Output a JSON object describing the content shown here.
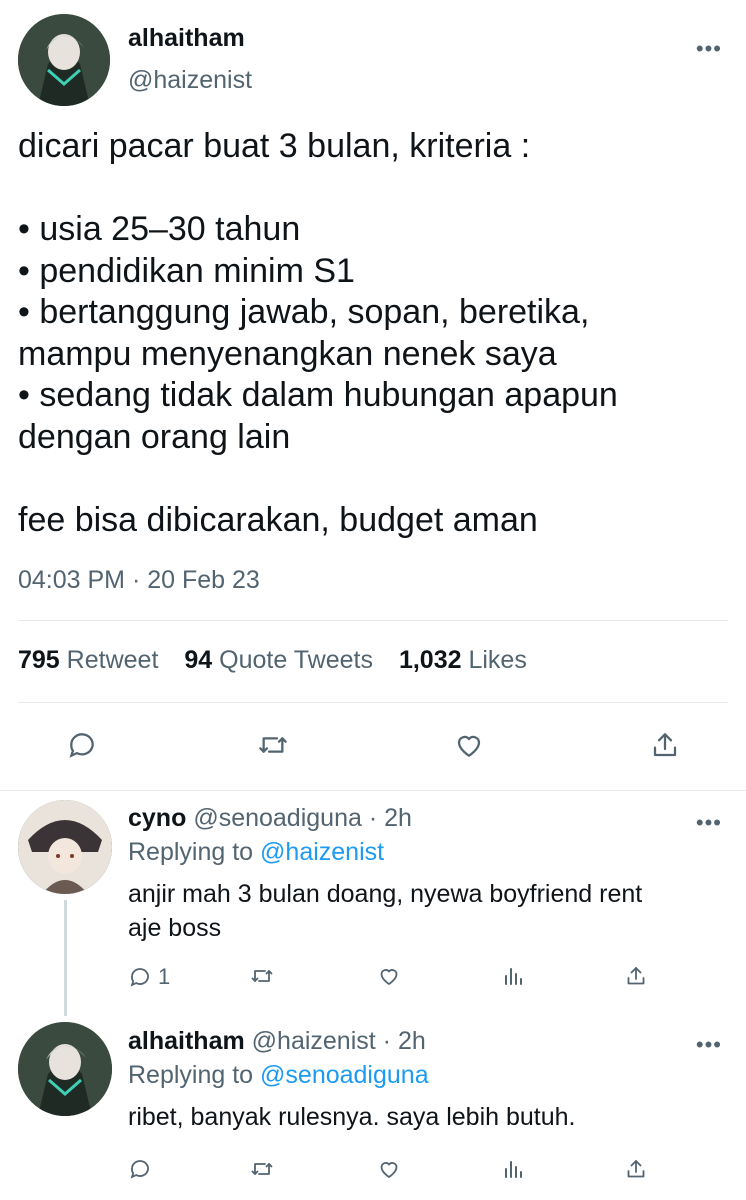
{
  "main_tweet": {
    "display_name": "alhaitham",
    "handle": "@haizenist",
    "more": "•••",
    "text": "dicari pacar buat 3 bulan, kriteria :\n\n• usia 25–30 tahun\n• pendidikan minim S1\n• bertanggung jawab, sopan, beretika,\nmampu menyenangkan nenek saya\n• sedang tidak dalam hubungan apapun\ndengan orang lain\n\nfee bisa dibicarakan, budget aman",
    "timestamp": "04:03 PM · 20 Feb 23",
    "stats": {
      "retweets": "795",
      "retweets_label": "Retweet",
      "quotes": "94",
      "quotes_label": "Quote Tweets",
      "likes": "1,032",
      "likes_label": "Likes"
    },
    "actions": [
      "reply-icon",
      "retweet-icon",
      "like-icon",
      "share-icon"
    ]
  },
  "replies": [
    {
      "display_name": "cyno",
      "handle": "@senoadiguna",
      "age": "· 2h",
      "replying_prefix": "Replying to",
      "replying_to": "@haizenist",
      "text": "anjir mah 3 bulan doang, nyewa boyfriend rent\naje boss",
      "reply_count": "1",
      "more": "•••"
    },
    {
      "display_name": "alhaitham",
      "handle": "@haizenist",
      "age": "· 2h",
      "replying_prefix": "Replying to",
      "replying_to": "@senoadiguna",
      "text": "ribet, banyak rulesnya. saya lebih butuh.",
      "reply_count": "",
      "more": "•••"
    }
  ],
  "colors": {
    "accent": "#1d9bf0",
    "muted": "#536471",
    "text": "#0f1419",
    "divider": "#e6e9eb"
  }
}
